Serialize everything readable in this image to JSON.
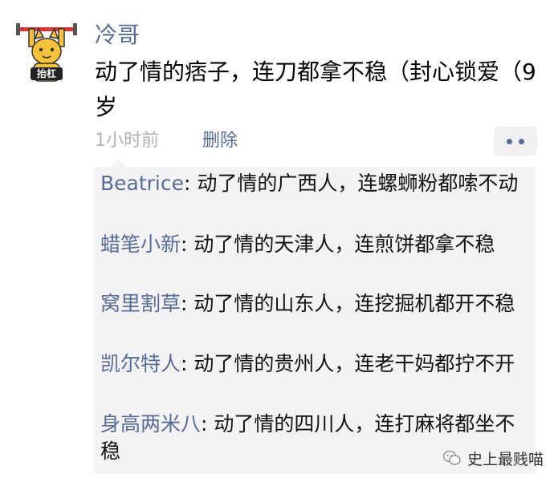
{
  "moment": {
    "username": "冷哥",
    "text": "动了情的痞子，连刀都拿不稳（封心锁爱（9岁",
    "time": "1小时前",
    "delete_label": "删除",
    "avatar_caption": "抬杠"
  },
  "comments": [
    {
      "author": "Beatrice",
      "separator": ": ",
      "text": "动了情的广西人，连螺蛳粉都嗦不动"
    },
    {
      "author": "蜡笔小新",
      "separator": ": ",
      "text": "动了情的天津人，连煎饼都拿不稳"
    },
    {
      "author": "窝里割草",
      "separator": ": ",
      "text": "动了情的山东人，连挖掘机都开不稳"
    },
    {
      "author": "凯尔特人",
      "separator": ": ",
      "text": "动了情的贵州人，连老干妈都拧不开"
    },
    {
      "author": "身高两米八",
      "separator": ": ",
      "text": "动了情的四川人，连打麻将都坐不稳"
    }
  ],
  "watermark": {
    "text": "史上最贱喵"
  },
  "colors": {
    "link": "#576b95",
    "comment_bg": "#f3f3f5",
    "time": "#b2b2b2"
  }
}
